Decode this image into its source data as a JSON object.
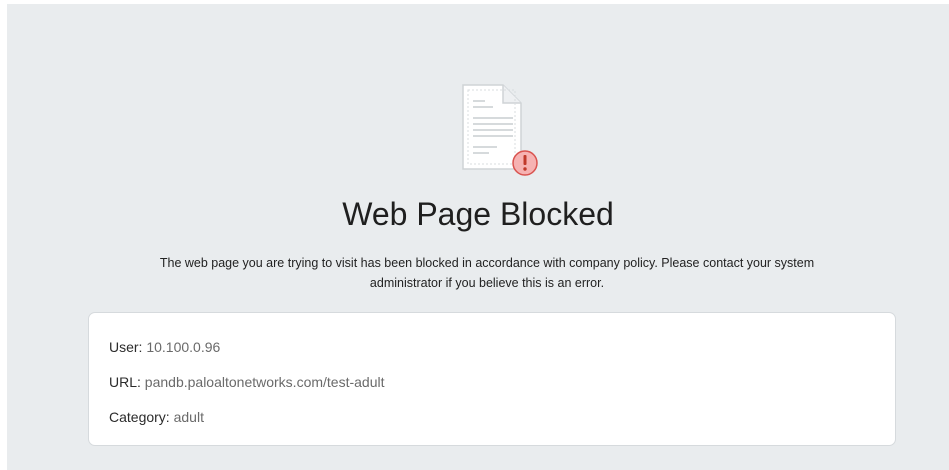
{
  "icon": "blocked-document-icon",
  "title": "Web Page Blocked",
  "message": "The web page you are trying to visit has been blocked in accordance with company policy. Please contact your system administrator if you believe this is an error.",
  "details": {
    "user_label": "User:",
    "user_value": "10.100.0.96",
    "url_label": "URL:",
    "url_value": "pandb.paloaltonetworks.com/test-adult",
    "category_label": "Category:",
    "category_value": "adult"
  },
  "colors": {
    "background": "#e9ecee",
    "card": "#ffffff",
    "alert": "#f4a6a6",
    "alert_border": "#d9534f"
  }
}
